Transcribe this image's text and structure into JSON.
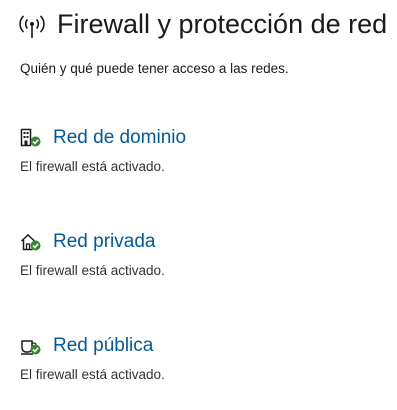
{
  "header": {
    "title": "Firewall y protección de red",
    "subtitle": "Quién y qué puede tener acceso a las redes.",
    "icon": "wifi-antenna-icon"
  },
  "networks": [
    {
      "label": "Red de dominio",
      "status": "El firewall está activado.",
      "icon": "domain-building-icon",
      "check_color": "#2e8b2e"
    },
    {
      "label": "Red privada",
      "status": "El firewall está activado.",
      "icon": "private-home-icon",
      "check_color": "#2e8b2e"
    },
    {
      "label": "Red pública",
      "status": "El firewall está activado.",
      "icon": "public-cafe-icon",
      "check_color": "#2e8b2e"
    }
  ],
  "colors": {
    "link": "#005a9e",
    "text": "#1a1a1a",
    "ok": "#2e8b2e"
  }
}
